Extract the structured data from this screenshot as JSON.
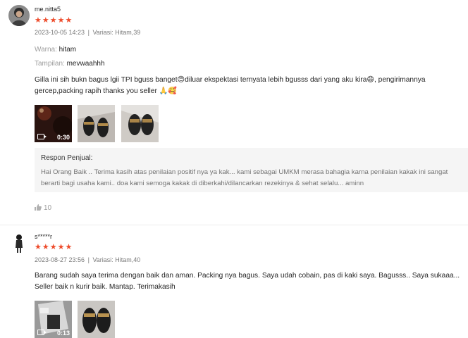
{
  "reviews": [
    {
      "username": "me.nitta5",
      "stars": "★★★★★",
      "date": "2023-10-05 14:23",
      "separator": "|",
      "variation": "Variasi: Hitam,39",
      "attributes": [
        {
          "label": "Warna:",
          "value": "hitam"
        },
        {
          "label": "Tampilan:",
          "value": "mevwaahhh"
        }
      ],
      "comment": "Gilla ini sih bukn bagus lgii TPI bguss banget😍diluar ekspektasi ternyata lebih bgusss dari yang aku kira😄, pengirimannya gercep,packing rapih thanks you seller 🙏🥰",
      "media": [
        {
          "type": "video",
          "duration": "0:30"
        },
        {
          "type": "image"
        },
        {
          "type": "image"
        }
      ],
      "seller_response": {
        "title": "Respon Penjual:",
        "text": "Hai Orang Baik .. Terima kasih atas penilaian positif nya ya kak... kami sebagai UMKM merasa bahagia karna penilaian kakak ini sangat berarti bagi usaha kami.. doa kami semoga kakak di diberkahi/dilancarkan rezekinya & sehat selalu... aminn"
      },
      "likes": "10"
    },
    {
      "username": "s*****r",
      "stars": "★★★★★",
      "date": "2023-08-27 23:56",
      "separator": "|",
      "variation": "Variasi: Hitam,40",
      "comment": "Barang sudah saya terima dengan baik dan aman. Packing nya bagus. Saya udah cobain, pas di kaki saya. Bagusss.. Saya sukaaa... Seller baik n kurir baik. Mantap. Terimakasih",
      "media": [
        {
          "type": "video",
          "duration": "0:13"
        },
        {
          "type": "image"
        }
      ]
    }
  ],
  "colors": {
    "star": "#ee4d2d",
    "response_bg": "#f5f5f5"
  }
}
